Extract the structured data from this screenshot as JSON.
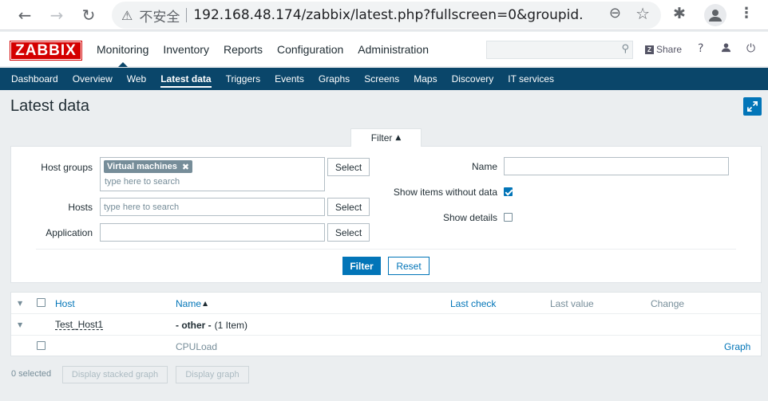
{
  "browser": {
    "back_icon": "arrow-left-icon",
    "forward_icon": "arrow-right-icon",
    "reload_icon": "reload-icon",
    "security_label": "不安全",
    "url": "192.168.48.174/zabbix/latest.php?fullscreen=0&groupid...",
    "zoom_icon": "zoom-out-icon",
    "bookmark_icon": "star-icon",
    "extensions_icon": "puzzle-icon",
    "profile_icon": "person-icon",
    "menu_icon": "kebab-menu-icon"
  },
  "header": {
    "logo": "ZABBIX",
    "menu": [
      "Monitoring",
      "Inventory",
      "Reports",
      "Configuration",
      "Administration"
    ],
    "active_menu": "Monitoring",
    "search_placeholder": "",
    "share_label": "Share",
    "help_label": "?"
  },
  "submenu": {
    "items": [
      "Dashboard",
      "Overview",
      "Web",
      "Latest data",
      "Triggers",
      "Events",
      "Graphs",
      "Screens",
      "Maps",
      "Discovery",
      "IT services"
    ],
    "active": "Latest data"
  },
  "page": {
    "title": "Latest data"
  },
  "filter": {
    "tab_label": "Filter",
    "host_groups_label": "Host groups",
    "host_groups_selected": "Virtual machines",
    "host_groups_placeholder": "type here to search",
    "hosts_label": "Hosts",
    "hosts_placeholder": "type here to search",
    "application_label": "Application",
    "application_value": "",
    "select_label": "Select",
    "name_label": "Name",
    "name_value": "",
    "show_without_data_label": "Show items without data",
    "show_without_data_checked": true,
    "show_details_label": "Show details",
    "show_details_checked": false,
    "filter_button": "Filter",
    "reset_button": "Reset"
  },
  "table": {
    "columns": {
      "host": "Host",
      "name": "Name",
      "last_check": "Last check",
      "last_value": "Last value",
      "change": "Change"
    },
    "sort_indicator": "▲",
    "group_row": {
      "host": "Test_Host1",
      "app": "- other -",
      "count": "(1 Item)"
    },
    "item_row": {
      "name": "CPULoad",
      "action": "Graph"
    }
  },
  "footer": {
    "selected": "0 selected",
    "stacked_graph": "Display stacked graph",
    "display_graph": "Display graph"
  }
}
